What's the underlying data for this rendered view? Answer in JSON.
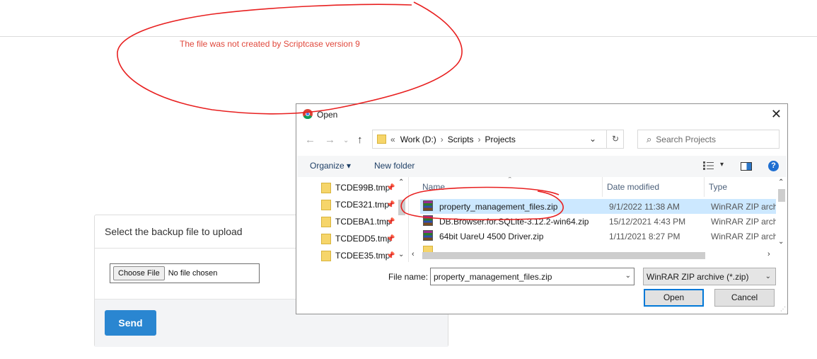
{
  "page": {
    "error_message": "The file was not created by Scriptcase version 9"
  },
  "upload_panel": {
    "heading": "Select the backup file to upload",
    "choose_file_label": "Choose File",
    "no_file_text": "No file chosen",
    "send_label": "Send",
    "send_color": "#2a86d1"
  },
  "dialog": {
    "title": "Open",
    "close_glyph": "✕",
    "breadcrumb": {
      "prefix": "«",
      "parts": [
        "Work (D:)",
        "Scripts",
        "Projects"
      ],
      "separator": "›"
    },
    "search_placeholder": "Search Projects",
    "toolbar": {
      "organize_label": "Organize ▾",
      "new_folder_label": "New folder",
      "help_glyph": "?"
    },
    "tree_items": [
      {
        "label": "TCDE99B.tmp"
      },
      {
        "label": "TCDE321.tmp"
      },
      {
        "label": "TCDEBA1.tmp"
      },
      {
        "label": "TCDEDD5.tmp"
      },
      {
        "label": "TCDEE35.tmp"
      }
    ],
    "columns": {
      "name": "Name",
      "date": "Date modified",
      "type": "Type"
    },
    "files": [
      {
        "name": "property_management_files.zip",
        "date": "9/1/2022 11:38 AM",
        "type": "WinRAR ZIP archive",
        "selected": true
      },
      {
        "name": "DB.Browser.for.SQLite-3.12.2-win64.zip",
        "date": "15/12/2021 4:43 PM",
        "type": "WinRAR ZIP archive",
        "selected": false
      },
      {
        "name": "64bit UareU 4500 Driver.zip",
        "date": "1/11/2021 8:27 PM",
        "type": "WinRAR ZIP archive",
        "selected": false
      }
    ],
    "file_name_label": "File name:",
    "file_name_value": "property_management_files.zip",
    "file_type_value": "WinRAR ZIP archive (*.zip)",
    "open_label": "Open",
    "cancel_label": "Cancel",
    "accent_color": "#0078d7"
  }
}
